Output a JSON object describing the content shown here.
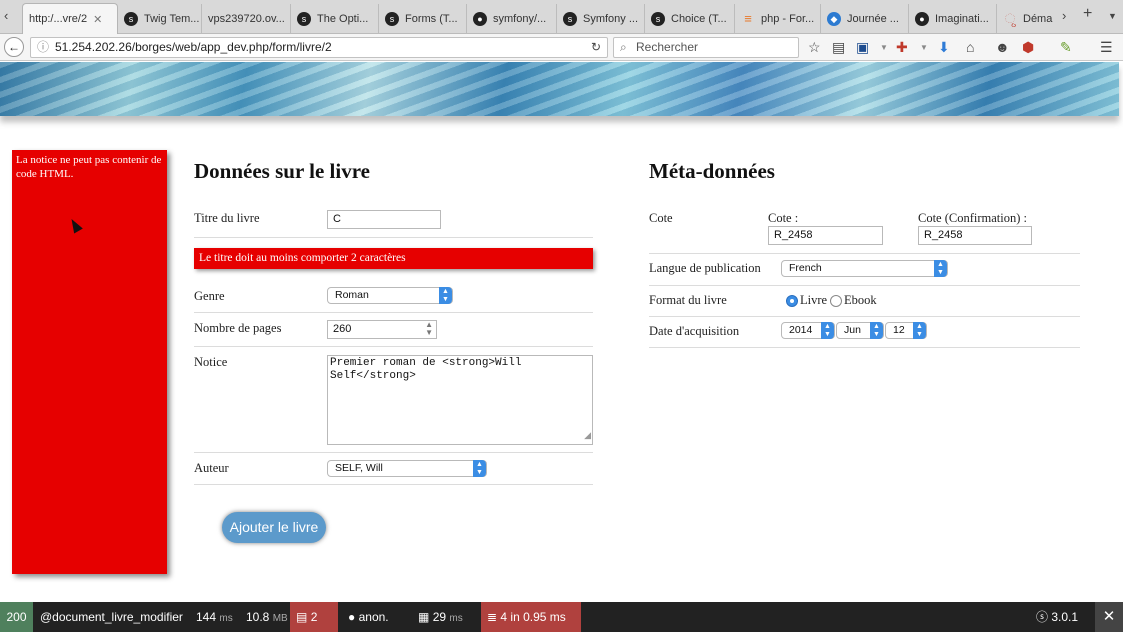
{
  "browser": {
    "tabs": [
      {
        "label": "http:/...vre/2",
        "icon": "none",
        "active": true
      },
      {
        "label": "Twig Tem...",
        "icon": "symfony"
      },
      {
        "label": "vps239720.ov...",
        "icon": "none"
      },
      {
        "label": "The Opti...",
        "icon": "symfony"
      },
      {
        "label": "Forms (T...",
        "icon": "symfony"
      },
      {
        "label": "symfony/...",
        "icon": "github"
      },
      {
        "label": "Symfony ...",
        "icon": "symfony"
      },
      {
        "label": "Choice (T...",
        "icon": "symfony"
      },
      {
        "label": "php - For...",
        "icon": "stackoverflow"
      },
      {
        "label": "Journée ...",
        "icon": "globe"
      },
      {
        "label": "Imaginati...",
        "icon": "github"
      },
      {
        "label": "Déma",
        "icon": "page"
      }
    ],
    "close_glyph": "✕",
    "url": "51.254.202.26/borges/web/app_dev.php/form/livre/2",
    "search_placeholder": "Rechercher"
  },
  "left_error": "La notice ne peut pas contenir de code HTML.",
  "livre": {
    "heading": "Données sur le livre",
    "titre_label": "Titre du livre",
    "titre_value": "C",
    "titre_error": "Le titre doit au moins comporter 2 caractères",
    "genre_label": "Genre",
    "genre_value": "Roman",
    "pages_label": "Nombre de pages",
    "pages_value": "260",
    "notice_label": "Notice",
    "notice_value": "Premier roman de <strong>Will Self</strong>",
    "auteur_label": "Auteur",
    "auteur_value": "SELF, Will",
    "submit_label": "Ajouter le livre"
  },
  "meta": {
    "heading": "Méta-données",
    "cote_label": "Cote",
    "cote_sub": "Cote :",
    "cote_value": "R_2458",
    "cote_conf_sub": "Cote (Confirmation) :",
    "cote_conf_value": "R_2458",
    "langue_label": "Langue de publication",
    "langue_value": "French",
    "format_label": "Format du livre",
    "format_opt1": "Livre",
    "format_opt2": "Ebook",
    "format_selected": "Livre",
    "date_label": "Date d'acquisition",
    "date_year": "2014",
    "date_month": "Jun",
    "date_day": "12"
  },
  "profiler": {
    "status": "200",
    "route": "@document_livre_modifier",
    "time": "144",
    "time_unit": "ms",
    "memory": "10.8",
    "memory_unit": "MB",
    "forms_count": "2",
    "user": "anon.",
    "twig_time": "29",
    "twig_unit": "ms",
    "db": "4 in 0.95 ms",
    "version": "3.0.1",
    "status_color": "#4f805d",
    "error_color": "#b0413e"
  }
}
